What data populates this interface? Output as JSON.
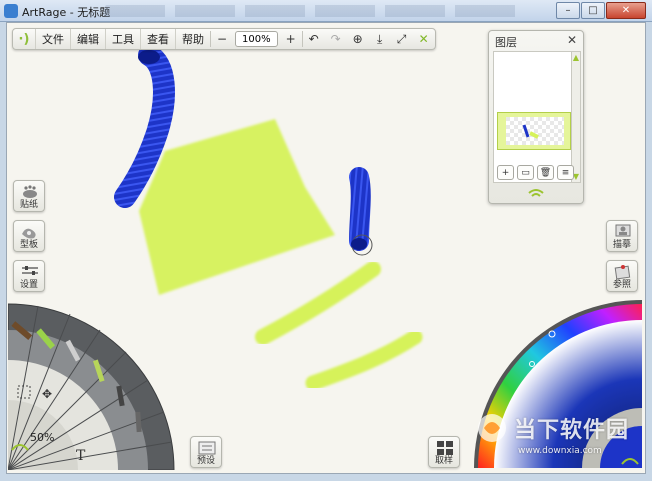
{
  "window": {
    "title": "ArtRage - 无标题",
    "minimize": "–",
    "maximize": "□",
    "close": "✕"
  },
  "toolbar": {
    "logo": "·)",
    "menus": [
      "文件",
      "编辑",
      "工具",
      "查看",
      "帮助"
    ],
    "zoom_minus": "−",
    "zoom_value": "100%",
    "zoom_plus": "+",
    "undo": "↶",
    "redo": "↷",
    "rotate": "⊕",
    "download": "⤓",
    "expand": "⤢",
    "close": "✕"
  },
  "layers_panel": {
    "title": "图层",
    "close": "✕",
    "scroll_up": "▲",
    "scroll_down": "▼",
    "buttons": [
      "+",
      "▭",
      "🗑",
      "≡"
    ]
  },
  "left_tools": {
    "stickers": "贴纸",
    "stencils": "型板",
    "settings": "设置"
  },
  "right_tools": {
    "trace": "描摹",
    "reference": "参照"
  },
  "bottom": {
    "zoom_level": "50%",
    "presets": "预设",
    "sample": "取样"
  },
  "watermark": {
    "text": "当下软件园",
    "url": "www.downxia.com"
  },
  "colors": {
    "accent": "#9cc430",
    "paint_blue": "#1d34c8",
    "paint_lime": "#d6f25a"
  }
}
